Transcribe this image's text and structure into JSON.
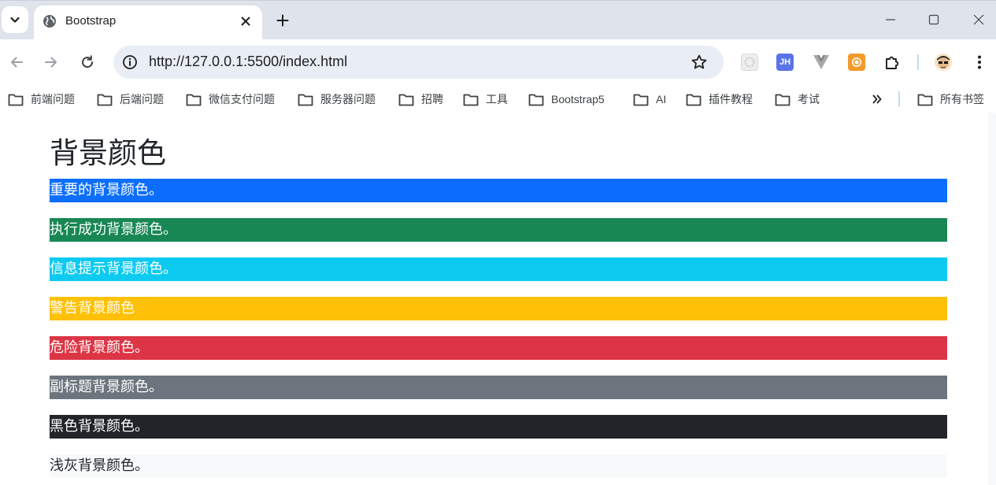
{
  "browser": {
    "tab_title": "Bootstrap",
    "url": "http://127.0.0.1:5500/index.html",
    "extensions": [
      {
        "name": "ext-grid-icon",
        "label": ""
      },
      {
        "name": "ext-jh-icon",
        "label": "JH"
      },
      {
        "name": "ext-vue-icon",
        "label": ""
      },
      {
        "name": "ext-orange-icon",
        "label": ""
      },
      {
        "name": "extensions-puzzle-icon",
        "label": ""
      }
    ]
  },
  "bookmarks": [
    {
      "label": "前端问题"
    },
    {
      "label": "后端问题"
    },
    {
      "label": "微信支付问题"
    },
    {
      "label": "服务器问题"
    },
    {
      "label": "招聘"
    },
    {
      "label": "工具"
    },
    {
      "label": "Bootstrap5"
    },
    {
      "label": "AI"
    },
    {
      "label": "插件教程"
    },
    {
      "label": "考试"
    }
  ],
  "all_bookmarks_label": "所有书签",
  "page": {
    "heading": "背景颜色",
    "rows": [
      {
        "text": "重要的背景颜色。",
        "bg": "#0d6efd",
        "color": "#ffffff"
      },
      {
        "text": "执行成功背景颜色。",
        "bg": "#198754",
        "color": "#ffffff"
      },
      {
        "text": "信息提示背景颜色。",
        "bg": "#0dcaf0",
        "color": "#ffffff"
      },
      {
        "text": "警告背景颜色",
        "bg": "#ffc107",
        "color": "#ffffff"
      },
      {
        "text": "危险背景颜色。",
        "bg": "#dc3545",
        "color": "#ffffff"
      },
      {
        "text": "副标题背景颜色。",
        "bg": "#6c757d",
        "color": "#ffffff"
      },
      {
        "text": "黑色背景颜色。",
        "bg": "#212529",
        "color": "#ffffff"
      },
      {
        "text": "浅灰背景颜色。",
        "bg": "#f8f9fa",
        "color": "#212529"
      }
    ]
  }
}
